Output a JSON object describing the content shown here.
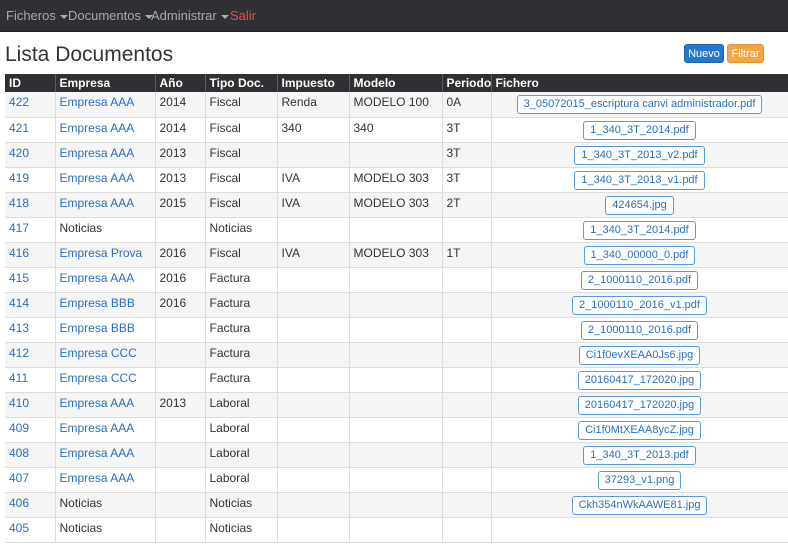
{
  "nav": {
    "items": [
      {
        "label": "Ficheros",
        "dropdown": true
      },
      {
        "label": "Documentos",
        "dropdown": true
      },
      {
        "label": "Administrar",
        "dropdown": true
      },
      {
        "label": "Salir",
        "dropdown": false
      }
    ]
  },
  "page": {
    "title": "Lista Documentos",
    "nuevo_label": "Nuevo",
    "filtrar_label": "Filtrar"
  },
  "colors": {
    "navbar": "#2e3033",
    "link": "#2a70bb",
    "salir": "#e05050",
    "nuevo": "#2778c8",
    "filtrar": "#f3a544"
  },
  "table": {
    "headers": [
      "ID",
      "Empresa",
      "Año",
      "Tipo Doc.",
      "Impuesto",
      "Modelo",
      "Periodo",
      "Fichero"
    ],
    "rows": [
      {
        "id": "422",
        "empresa": "Empresa AAA",
        "ano": "2014",
        "tipo": "Fiscal",
        "impuesto": "Renda",
        "modelo": "MODELO 100",
        "periodo": "0A",
        "fichero": "3_05072015_escriptura canvi administrador.pdf"
      },
      {
        "id": "421",
        "empresa": "Empresa AAA",
        "ano": "2014",
        "tipo": "Fiscal",
        "impuesto": "340",
        "modelo": "340",
        "periodo": "3T",
        "fichero": "1_340_3T_2014.pdf"
      },
      {
        "id": "420",
        "empresa": "Empresa AAA",
        "ano": "2013",
        "tipo": "Fiscal",
        "impuesto": "",
        "modelo": "",
        "periodo": "3T",
        "fichero": "1_340_3T_2013_v2.pdf"
      },
      {
        "id": "419",
        "empresa": "Empresa AAA",
        "ano": "2013",
        "tipo": "Fiscal",
        "impuesto": "IVA",
        "modelo": "MODELO 303",
        "periodo": "3T",
        "fichero": "1_340_3T_2013_v1.pdf"
      },
      {
        "id": "418",
        "empresa": "Empresa AAA",
        "ano": "2015",
        "tipo": "Fiscal",
        "impuesto": "IVA",
        "modelo": "MODELO 303",
        "periodo": "2T",
        "fichero": "424654.jpg"
      },
      {
        "id": "417",
        "empresa": "Noticias",
        "ano": "",
        "tipo": "Noticias",
        "impuesto": "",
        "modelo": "",
        "periodo": "",
        "fichero": "1_340_3T_2014.pdf"
      },
      {
        "id": "416",
        "empresa": "Empresa Prova",
        "ano": "2016",
        "tipo": "Fiscal",
        "impuesto": "IVA",
        "modelo": "MODELO 303",
        "periodo": "1T",
        "fichero": "1_340_00000_0.pdf"
      },
      {
        "id": "415",
        "empresa": "Empresa AAA",
        "ano": "2016",
        "tipo": "Factura",
        "impuesto": "",
        "modelo": "",
        "periodo": "",
        "fichero": "2_1000110_2016.pdf"
      },
      {
        "id": "414",
        "empresa": "Empresa BBB",
        "ano": "2016",
        "tipo": "Factura",
        "impuesto": "",
        "modelo": "",
        "periodo": "",
        "fichero": "2_1000110_2016_v1.pdf"
      },
      {
        "id": "413",
        "empresa": "Empresa BBB",
        "ano": "",
        "tipo": "Factura",
        "impuesto": "",
        "modelo": "",
        "periodo": "",
        "fichero": "2_1000110_2016.pdf"
      },
      {
        "id": "412",
        "empresa": "Empresa CCC",
        "ano": "",
        "tipo": "Factura",
        "impuesto": "",
        "modelo": "",
        "periodo": "",
        "fichero": "Ci1f0evXEAA0Js6.jpg"
      },
      {
        "id": "411",
        "empresa": "Empresa CCC",
        "ano": "",
        "tipo": "Factura",
        "impuesto": "",
        "modelo": "",
        "periodo": "",
        "fichero": "20160417_172020.jpg"
      },
      {
        "id": "410",
        "empresa": "Empresa AAA",
        "ano": "2013",
        "tipo": "Laboral",
        "impuesto": "",
        "modelo": "",
        "periodo": "",
        "fichero": "20160417_172020.jpg"
      },
      {
        "id": "409",
        "empresa": "Empresa AAA",
        "ano": "",
        "tipo": "Laboral",
        "impuesto": "",
        "modelo": "",
        "periodo": "",
        "fichero": "Ci1f0MtXEAA8ycZ.jpg"
      },
      {
        "id": "408",
        "empresa": "Empresa AAA",
        "ano": "",
        "tipo": "Laboral",
        "impuesto": "",
        "modelo": "",
        "periodo": "",
        "fichero": "1_340_3T_2013.pdf"
      },
      {
        "id": "407",
        "empresa": "Empresa AAA",
        "ano": "",
        "tipo": "Laboral",
        "impuesto": "",
        "modelo": "",
        "periodo": "",
        "fichero": "37293_v1.png"
      },
      {
        "id": "406",
        "empresa": "Noticias",
        "ano": "",
        "tipo": "Noticias",
        "impuesto": "",
        "modelo": "",
        "periodo": "",
        "fichero": "Ckh354nWkAAWE81.jpg"
      },
      {
        "id": "405",
        "empresa": "Noticias",
        "ano": "",
        "tipo": "Noticias",
        "impuesto": "",
        "modelo": "",
        "periodo": "",
        "fichero": ""
      }
    ]
  }
}
